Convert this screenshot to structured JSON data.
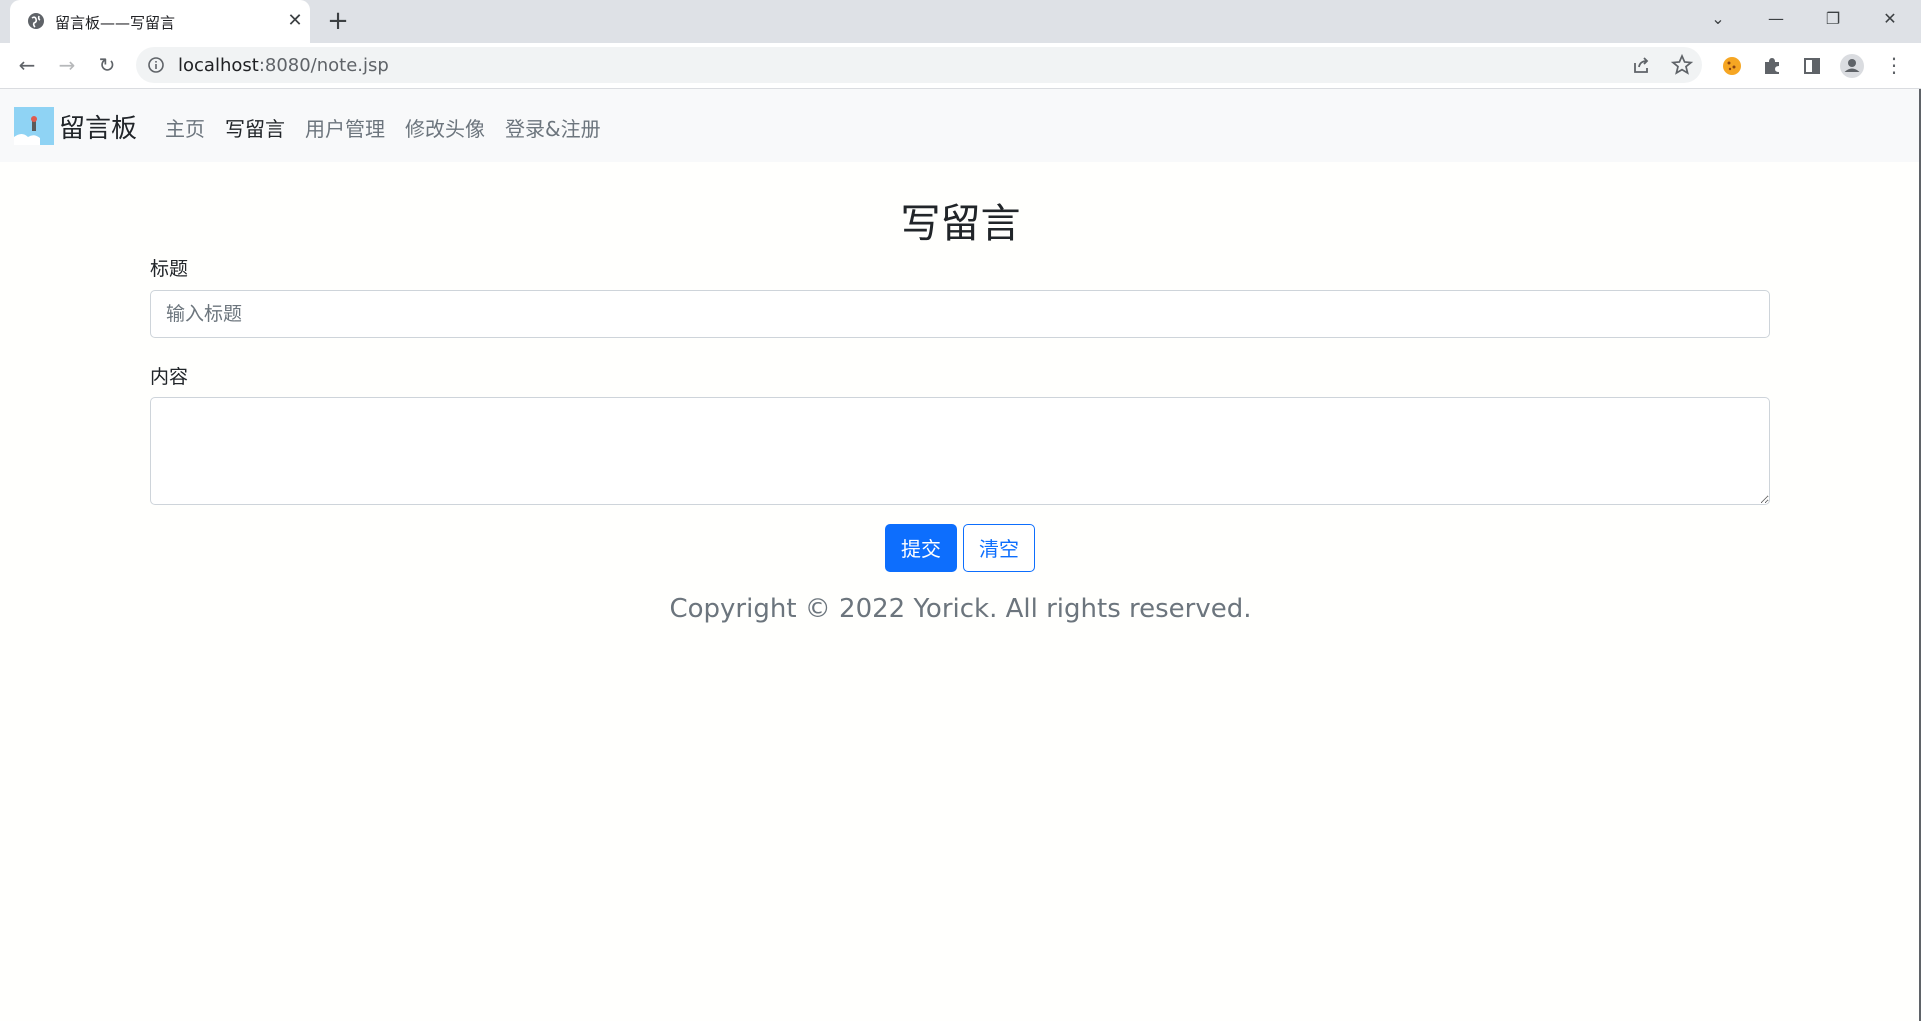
{
  "browser": {
    "tab_title": "留言板——写留言",
    "tab_close": "✕",
    "new_tab": "+",
    "url_host": "localhost",
    "url_rest": ":8080/note.jsp",
    "window_controls": {
      "menu": "⌄",
      "minimize": "—",
      "restore": "❐",
      "close": "✕"
    },
    "nav": {
      "back": "←",
      "forward": "→",
      "reload": "↻",
      "menu": "⋮"
    }
  },
  "navbar": {
    "brand": "留言板",
    "links": [
      "主页",
      "写留言",
      "用户管理",
      "修改头像",
      "登录&注册"
    ],
    "active": "写留言"
  },
  "form": {
    "heading": "写留言",
    "title_label": "标题",
    "title_placeholder": "输入标题",
    "title_value": "",
    "content_label": "内容",
    "content_value": "",
    "submit_label": "提交",
    "clear_label": "清空"
  },
  "footer": {
    "copyright": "Copyright © 2022 Yorick. All rights reserved."
  },
  "colors": {
    "primary": "#0d6efd",
    "navbar_bg": "#f8f9fa",
    "muted": "#6c757d"
  }
}
